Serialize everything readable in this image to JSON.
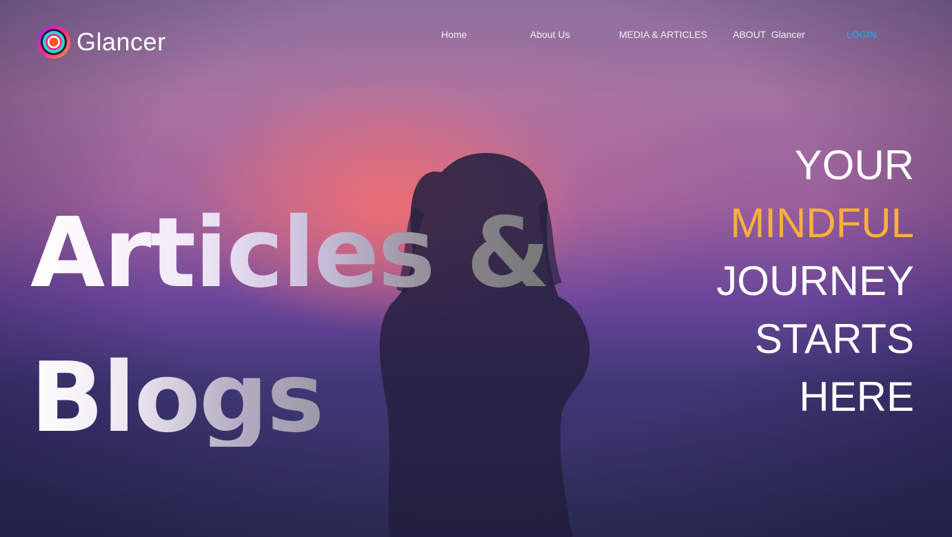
{
  "brand": {
    "name": "Glancer",
    "logo_icon": "concentric-rings-logo-icon"
  },
  "nav": {
    "items": [
      {
        "label": "Home"
      },
      {
        "label": "About Us"
      },
      {
        "label": "MEDIA & ARTICLES"
      },
      {
        "label": "ABOUT  Glancer"
      }
    ],
    "login": "LOGIN",
    "login_color": "#29a8f0"
  },
  "hero": {
    "headline_line1": "Articles &",
    "headline_line2": "Blogs",
    "tagline": [
      "YOUR",
      "MINDFUL",
      "JOURNEY",
      "STARTS",
      "HERE"
    ],
    "tagline_accent_color": "#f7b03c"
  }
}
